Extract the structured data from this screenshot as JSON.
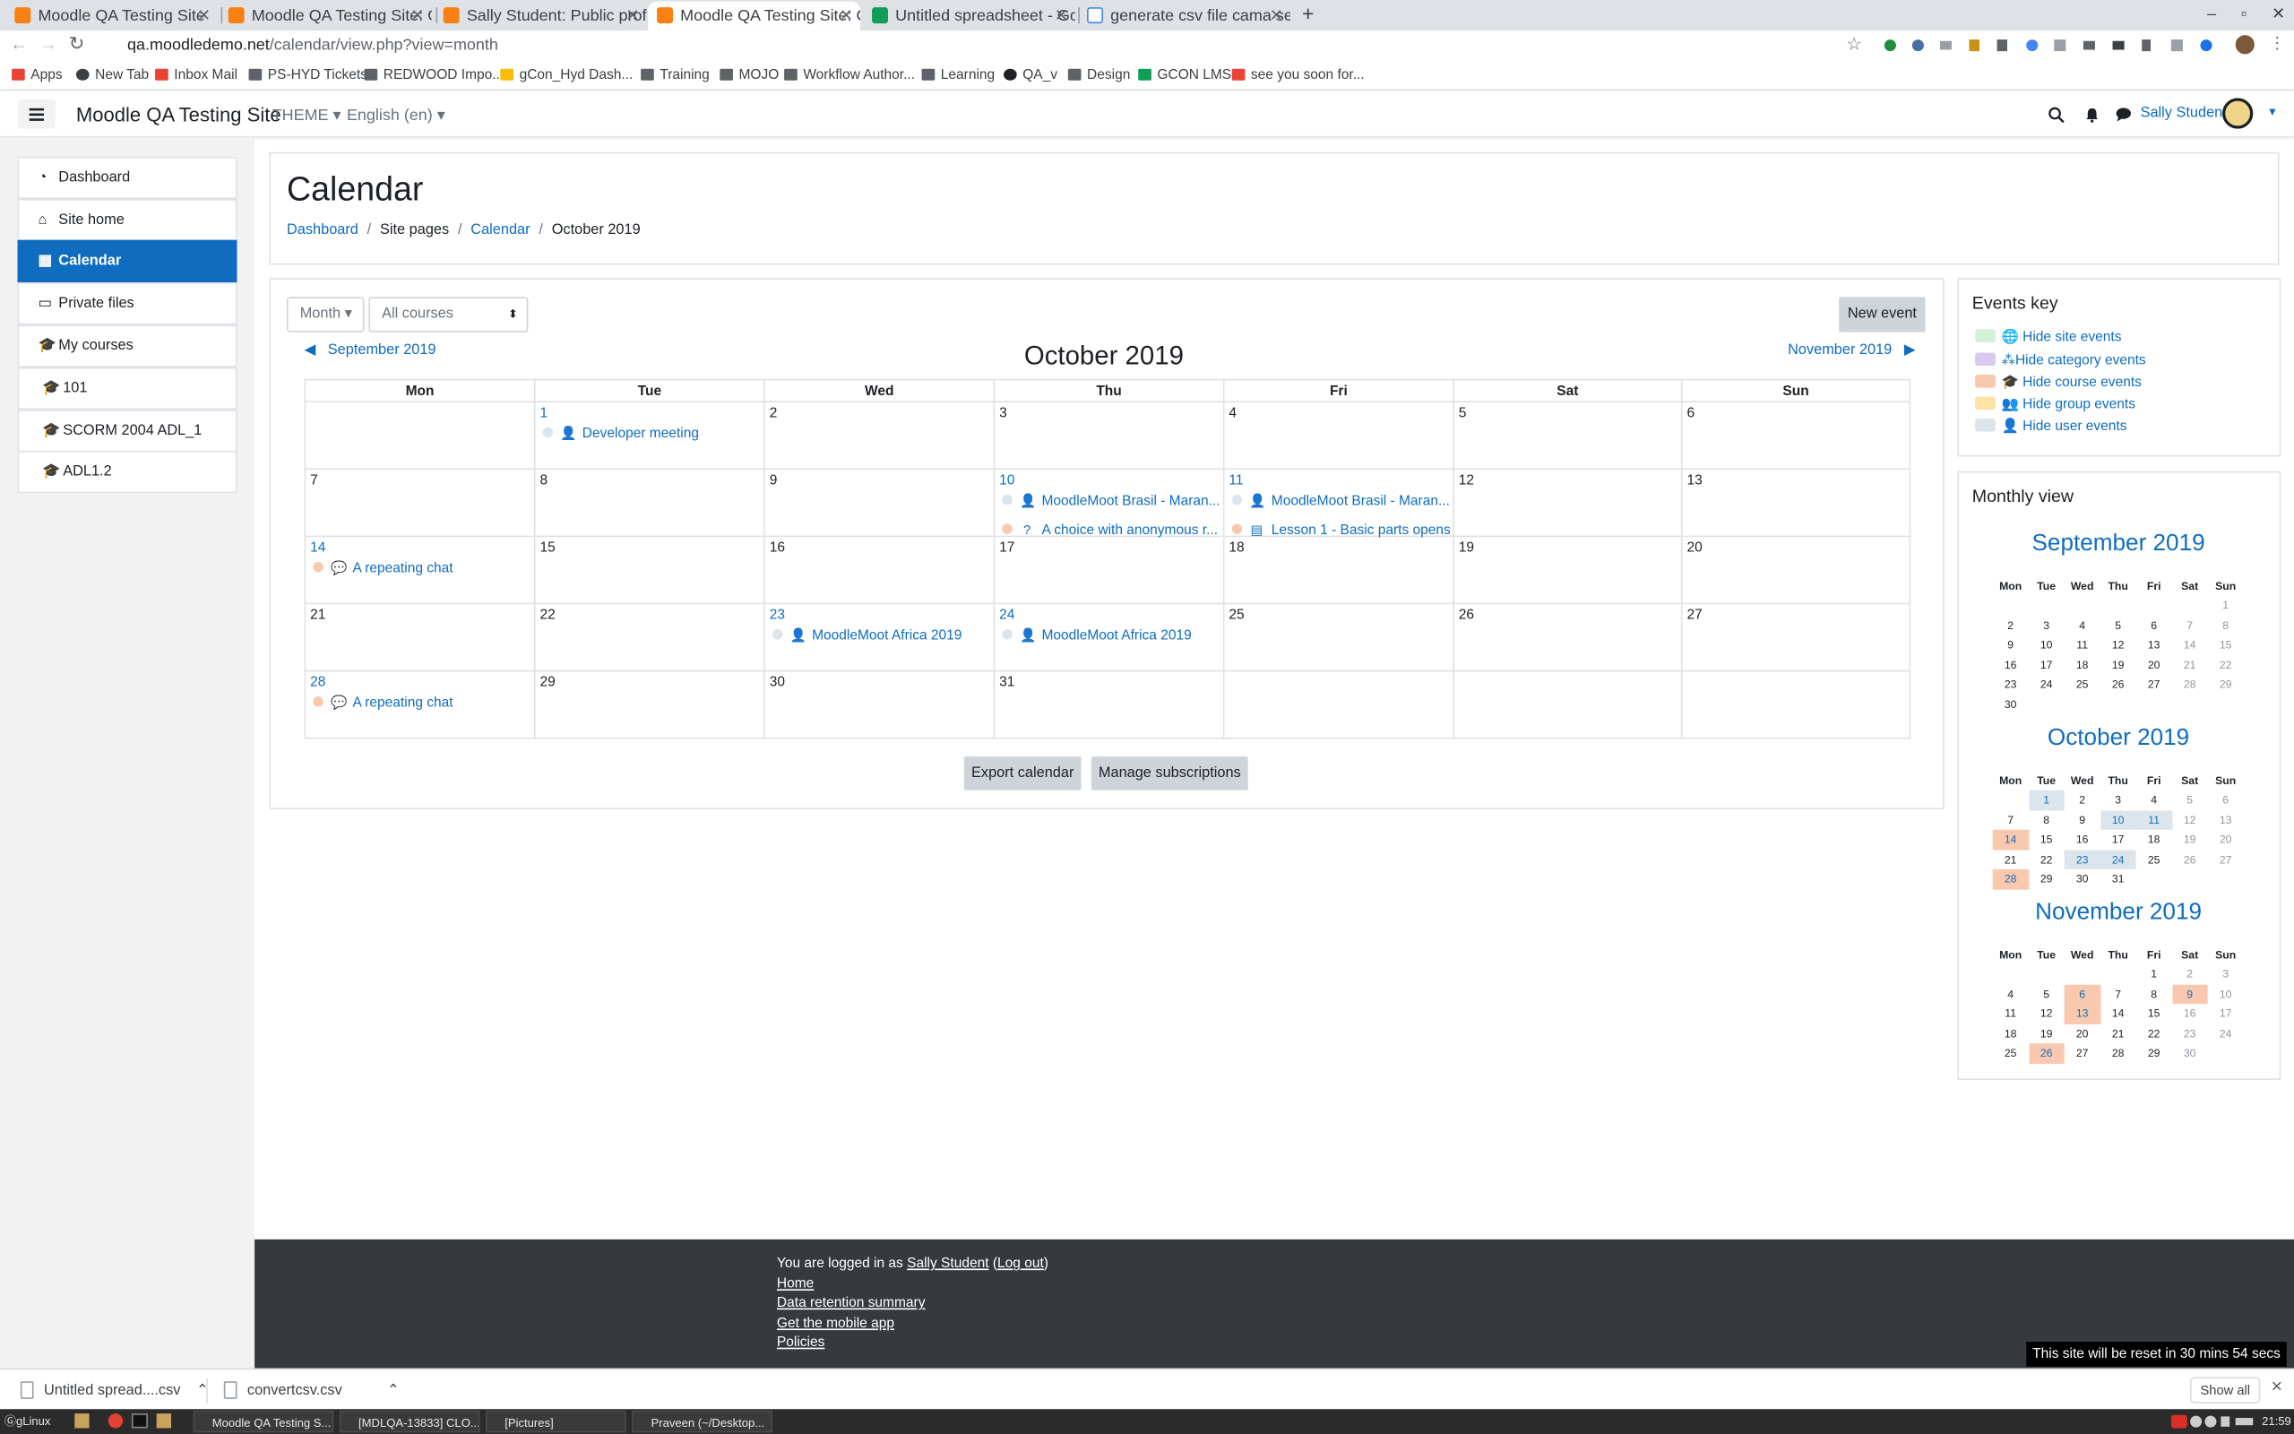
{
  "browser": {
    "tabs": [
      {
        "title": "Moodle QA Testing Site",
        "icon": "moodle-icon"
      },
      {
        "title": "Moodle QA Testing Site: Calen",
        "icon": "moodle-icon"
      },
      {
        "title": "Sally Student: Public profile",
        "icon": "moodle-icon"
      },
      {
        "title": "Moodle QA Testing Site: Calen",
        "icon": "moodle-icon"
      },
      {
        "title": "Untitled spreadsheet - Googl",
        "icon": "sheets-icon"
      },
      {
        "title": "generate csv file cama separ",
        "icon": "google-icon"
      }
    ],
    "url_host": "qa.moodledemo.net",
    "url_path": "/calendar/view.php?view=month",
    "bookmarks": [
      "Apps",
      "New Tab",
      "Inbox Mail",
      "PS-HYD Tickets",
      "REDWOOD Impo...",
      "gCon_Hyd Dash...",
      "Training",
      "MOJO",
      "Workflow Author...",
      "Learning",
      "QA_v",
      "Design",
      "GCON LMS",
      "see you soon for..."
    ]
  },
  "navbar": {
    "site_name": "Moodle QA Testing Site",
    "theme_label": "THEME",
    "language_label": "English (en)",
    "user_name": "Sally Student"
  },
  "drawer": {
    "items": [
      "Dashboard",
      "Site home",
      "Calendar",
      "Private files",
      "My courses",
      "101",
      "SCORM 2004 ADL_1",
      "ADL1.2"
    ],
    "active": "Calendar"
  },
  "header": {
    "title": "Calendar",
    "breadcrumb": [
      "Dashboard",
      "Site pages",
      "Calendar",
      "October 2019"
    ]
  },
  "calendar": {
    "view_select": "Month",
    "course_select": "All courses",
    "new_event_label": "New event",
    "prev_month": "September 2019",
    "next_month": "November 2019",
    "month_title": "October 2019",
    "weekdays": [
      "Mon",
      "Tue",
      "Wed",
      "Thu",
      "Fri",
      "Sat",
      "Sun"
    ],
    "weeks": [
      [
        "",
        "1",
        "2",
        "3",
        "4",
        "5",
        "6"
      ],
      [
        "7",
        "8",
        "9",
        "10",
        "11",
        "12",
        "13"
      ],
      [
        "14",
        "15",
        "16",
        "17",
        "18",
        "19",
        "20"
      ],
      [
        "21",
        "22",
        "23",
        "24",
        "25",
        "26",
        "27"
      ],
      [
        "28",
        "29",
        "30",
        "31",
        "",
        "",
        ""
      ]
    ],
    "day_links": [
      "1",
      "10",
      "11",
      "14",
      "23",
      "24",
      "28"
    ],
    "events": [
      {
        "day": "1",
        "title": "Developer meeting",
        "type": "user",
        "icon": "user-icon"
      },
      {
        "day": "10",
        "title": "MoodleMoot Brasil - Maran...",
        "type": "user",
        "icon": "user-icon"
      },
      {
        "day": "10",
        "title": "A choice with anonymous r...",
        "type": "course",
        "icon": "question-icon"
      },
      {
        "day": "11",
        "title": "MoodleMoot Brasil - Maran...",
        "type": "user",
        "icon": "user-icon"
      },
      {
        "day": "11",
        "title": "Lesson 1 - Basic parts opens",
        "type": "course",
        "icon": "lesson-icon"
      },
      {
        "day": "14",
        "title": "A repeating chat",
        "type": "course",
        "icon": "chat-icon"
      },
      {
        "day": "23",
        "title": "MoodleMoot Africa 2019",
        "type": "user",
        "icon": "user-icon"
      },
      {
        "day": "24",
        "title": "MoodleMoot Africa 2019",
        "type": "user",
        "icon": "user-icon"
      },
      {
        "day": "28",
        "title": "A repeating chat",
        "type": "course",
        "icon": "chat-icon"
      }
    ],
    "export_label": "Export calendar",
    "subscriptions_label": "Manage subscriptions"
  },
  "events_key": {
    "title": "Events key",
    "items": [
      {
        "label": "Hide site events",
        "color": "#d3f0d9",
        "icon": "globe-icon"
      },
      {
        "label": "Hide category events",
        "color": "#d9c8f0",
        "icon": "category-icon"
      },
      {
        "label": "Hide course events",
        "color": "#f8c9ae",
        "icon": "graduation-cap-icon"
      },
      {
        "label": "Hide group events",
        "color": "#fbe3a8",
        "icon": "group-icon"
      },
      {
        "label": "Hide user events",
        "color": "#dce5ec",
        "icon": "user-icon"
      }
    ]
  },
  "monthly_view": {
    "title": "Monthly view",
    "weekdays": [
      "Mon",
      "Tue",
      "Wed",
      "Thu",
      "Fri",
      "Sat",
      "Sun"
    ],
    "months": [
      {
        "name": "September 2019",
        "weeks": [
          [
            "",
            "",
            "",
            "",
            "",
            "",
            "1"
          ],
          [
            "2",
            "3",
            "4",
            "5",
            "6",
            "7",
            "8"
          ],
          [
            "9",
            "10",
            "11",
            "12",
            "13",
            "14",
            "15"
          ],
          [
            "16",
            "17",
            "18",
            "19",
            "20",
            "21",
            "22"
          ],
          [
            "23",
            "24",
            "25",
            "26",
            "27",
            "28",
            "29"
          ],
          [
            "30",
            "",
            "",
            "",
            "",
            "",
            ""
          ]
        ],
        "user_days": [],
        "course_days": []
      },
      {
        "name": "October 2019",
        "weeks": [
          [
            "",
            "1",
            "2",
            "3",
            "4",
            "5",
            "6"
          ],
          [
            "7",
            "8",
            "9",
            "10",
            "11",
            "12",
            "13"
          ],
          [
            "14",
            "15",
            "16",
            "17",
            "18",
            "19",
            "20"
          ],
          [
            "21",
            "22",
            "23",
            "24",
            "25",
            "26",
            "27"
          ],
          [
            "28",
            "29",
            "30",
            "31",
            "",
            "",
            ""
          ]
        ],
        "user_days": [
          "1",
          "10",
          "11",
          "23",
          "24"
        ],
        "course_days": [
          "14",
          "28"
        ]
      },
      {
        "name": "November 2019",
        "weeks": [
          [
            "",
            "",
            "",
            "",
            "1",
            "2",
            "3"
          ],
          [
            "4",
            "5",
            "6",
            "7",
            "8",
            "9",
            "10"
          ],
          [
            "11",
            "12",
            "13",
            "14",
            "15",
            "16",
            "17"
          ],
          [
            "18",
            "19",
            "20",
            "21",
            "22",
            "23",
            "24"
          ],
          [
            "25",
            "26",
            "27",
            "28",
            "29",
            "30",
            ""
          ]
        ],
        "user_days": [],
        "course_days": [
          "6",
          "9",
          "13",
          "26"
        ]
      }
    ]
  },
  "footer": {
    "logged_in_prefix": "You are logged in as",
    "user_name": "Sally Student",
    "logout_label": "Log out",
    "links": [
      "Home",
      "Data retention summary",
      "Get the mobile app",
      "Policies"
    ],
    "reset_notice": "This site will be reset in 30 mins 54 secs"
  },
  "downloads": {
    "files": [
      "Untitled spread....csv",
      "convertcsv.csv"
    ],
    "show_all_label": "Show all"
  },
  "taskbar": {
    "start_label": "gLinux",
    "windows": [
      "Moodle QA Testing S...",
      "[MDLQA-13833] CLO...",
      "[Pictures]",
      "Praveen (~/Desktop..."
    ],
    "clock": "21:59"
  }
}
